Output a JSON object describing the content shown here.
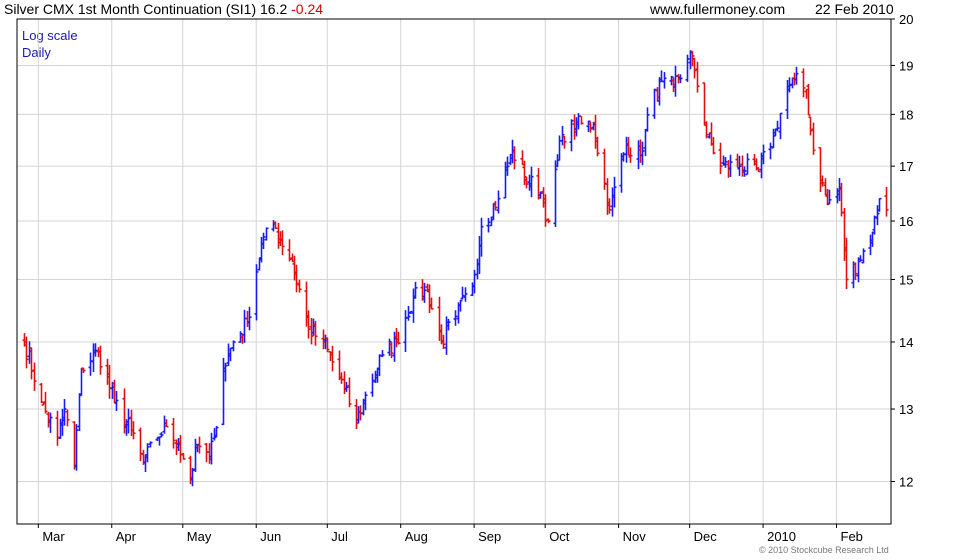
{
  "header": {
    "instrument": "Silver CMX 1st Month Continuation (SI1)",
    "last": "16.2",
    "change": "-0.24",
    "source": "www.fullermoney.com",
    "date": "22 Feb 2010"
  },
  "notes": {
    "scale": "Log scale",
    "period": "Daily"
  },
  "copyright": "© 2010 Stockcube Research Ltd",
  "colors": {
    "up": "#1a1aff",
    "down": "#e01010",
    "grid": "#d4d4d4",
    "axis": "#000000"
  },
  "chart_data": {
    "type": "bar",
    "style": "daily OHLC bars, blue = up day, red = down day",
    "title": "Silver CMX 1st Month Continuation (SI1)",
    "y_scale": "log",
    "y_ticks": [
      12,
      13,
      14,
      15,
      16,
      17,
      18,
      19,
      20
    ],
    "ylim": [
      11.45,
      20.0
    ],
    "x_ticks": [
      "Mar",
      "Apr",
      "May",
      "Jun",
      "Jul",
      "Aug",
      "Sep",
      "Oct",
      "Nov",
      "Dec",
      "2010",
      "Feb"
    ],
    "grid": true,
    "axis_side": "right",
    "anchors": [
      [
        "2009-02-23",
        14.0
      ],
      [
        "2009-03-02",
        13.1
      ],
      [
        "2009-03-09",
        12.6
      ],
      [
        "2009-03-12",
        13.0
      ],
      [
        "2009-03-16",
        12.2
      ],
      [
        "2009-03-19",
        13.6
      ],
      [
        "2009-03-26",
        13.85
      ],
      [
        "2009-04-02",
        13.1
      ],
      [
        "2009-04-09",
        12.7
      ],
      [
        "2009-04-14",
        12.25
      ],
      [
        "2009-04-20",
        12.6
      ],
      [
        "2009-04-24",
        12.75
      ],
      [
        "2009-04-29",
        12.5
      ],
      [
        "2009-05-04",
        12.05
      ],
      [
        "2009-05-07",
        12.5
      ],
      [
        "2009-05-12",
        12.3
      ],
      [
        "2009-05-14",
        12.6
      ],
      [
        "2009-05-18",
        13.6
      ],
      [
        "2009-05-22",
        14.0
      ],
      [
        "2009-05-28",
        14.3
      ],
      [
        "2009-06-03",
        15.6
      ],
      [
        "2009-06-08",
        15.95
      ],
      [
        "2009-06-16",
        15.3
      ],
      [
        "2009-06-23",
        14.2
      ],
      [
        "2009-06-29",
        14.0
      ],
      [
        "2009-07-08",
        13.3
      ],
      [
        "2009-07-13",
        12.8
      ],
      [
        "2009-07-17",
        13.2
      ],
      [
        "2009-07-24",
        13.8
      ],
      [
        "2009-07-30",
        14.0
      ],
      [
        "2009-08-06",
        14.7
      ],
      [
        "2009-08-12",
        14.8
      ],
      [
        "2009-08-18",
        14.0
      ],
      [
        "2009-08-24",
        14.4
      ],
      [
        "2009-08-31",
        14.9
      ],
      [
        "2009-09-04",
        15.9
      ],
      [
        "2009-09-11",
        16.4
      ],
      [
        "2009-09-17",
        17.3
      ],
      [
        "2009-09-22",
        16.8
      ],
      [
        "2009-09-29",
        16.5
      ],
      [
        "2009-10-02",
        16.0
      ],
      [
        "2009-10-08",
        17.6
      ],
      [
        "2009-10-14",
        17.8
      ],
      [
        "2009-10-21",
        17.8
      ],
      [
        "2009-10-28",
        16.2
      ],
      [
        "2009-11-04",
        17.4
      ],
      [
        "2009-11-10",
        17.2
      ],
      [
        "2009-11-16",
        18.5
      ],
      [
        "2009-11-24",
        18.6
      ],
      [
        "2009-12-02",
        19.2
      ],
      [
        "2009-12-08",
        17.6
      ],
      [
        "2009-12-14",
        17.0
      ],
      [
        "2009-12-22",
        17.0
      ],
      [
        "2009-12-30",
        16.9
      ],
      [
        "2010-01-06",
        17.7
      ],
      [
        "2010-01-11",
        18.5
      ],
      [
        "2010-01-14",
        18.7
      ],
      [
        "2010-01-19",
        18.5
      ],
      [
        "2010-01-22",
        17.3
      ],
      [
        "2010-01-28",
        16.3
      ],
      [
        "2010-02-02",
        16.6
      ],
      [
        "2010-02-05",
        15.0
      ],
      [
        "2010-02-10",
        15.3
      ],
      [
        "2010-02-16",
        15.8
      ],
      [
        "2010-02-19",
        16.4
      ],
      [
        "2010-02-22",
        16.2
      ]
    ]
  }
}
